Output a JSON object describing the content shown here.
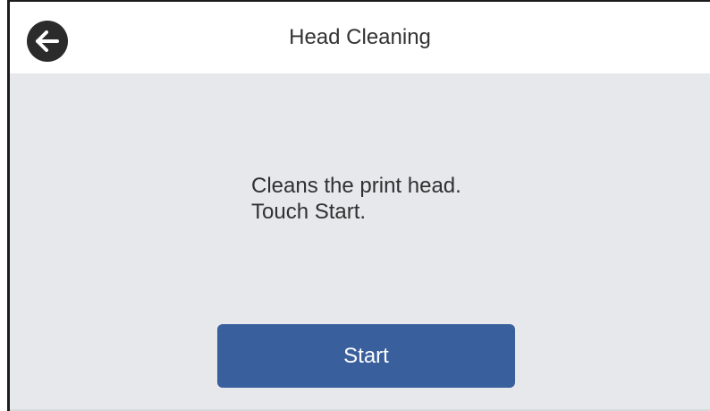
{
  "header": {
    "title": "Head Cleaning",
    "back_icon": "arrow-left-icon"
  },
  "message": {
    "line1": "Cleans the print head.",
    "line2": "Touch Start."
  },
  "actions": {
    "start_label": "Start"
  },
  "colors": {
    "header_bg": "#ffffff",
    "content_bg": "#e7e8ec",
    "button_bg": "#3a5f9d",
    "button_text": "#ffffff",
    "back_icon_bg": "#2b2b2b"
  }
}
